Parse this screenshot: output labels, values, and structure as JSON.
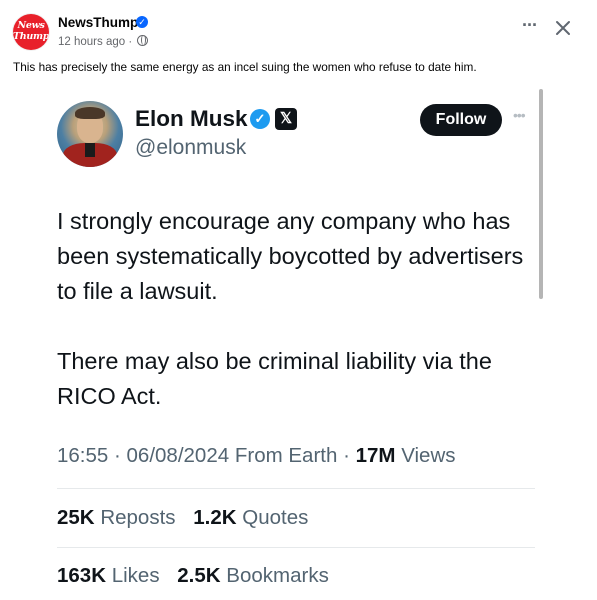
{
  "post": {
    "page_name": "NewsThump",
    "avatar_line1": "News",
    "avatar_line2": "Thump",
    "time": "12 hours ago",
    "meta_separator": "·",
    "caption": "This has precisely the same energy as an incel suing the women who refuse to date him.",
    "more_icon": "more-horizontal-icon",
    "close_icon": "close-icon",
    "verified_icon": "verified-badge-icon",
    "brand_color": "#e8202a"
  },
  "tweet": {
    "name": "Elon Musk",
    "handle": "@elonmusk",
    "follow_label": "Follow",
    "x_badge": "𝕏",
    "verified_color": "#1d9bf0",
    "paragraph1": "I strongly encourage any company who has been systematically boycotted by advertisers to file a lawsuit.",
    "paragraph2": "There may also be criminal liability via the RICO Act.",
    "time": "16:55",
    "date": "06/08/2024",
    "source": "From Earth",
    "views_count": "17M",
    "views_label": "Views",
    "reposts_count": "25K",
    "reposts_label": "Reposts",
    "quotes_count": "1.2K",
    "quotes_label": "Quotes",
    "likes_count": "163K",
    "likes_label": "Likes",
    "bookmarks_count": "2.5K",
    "bookmarks_label": "Bookmarks"
  }
}
